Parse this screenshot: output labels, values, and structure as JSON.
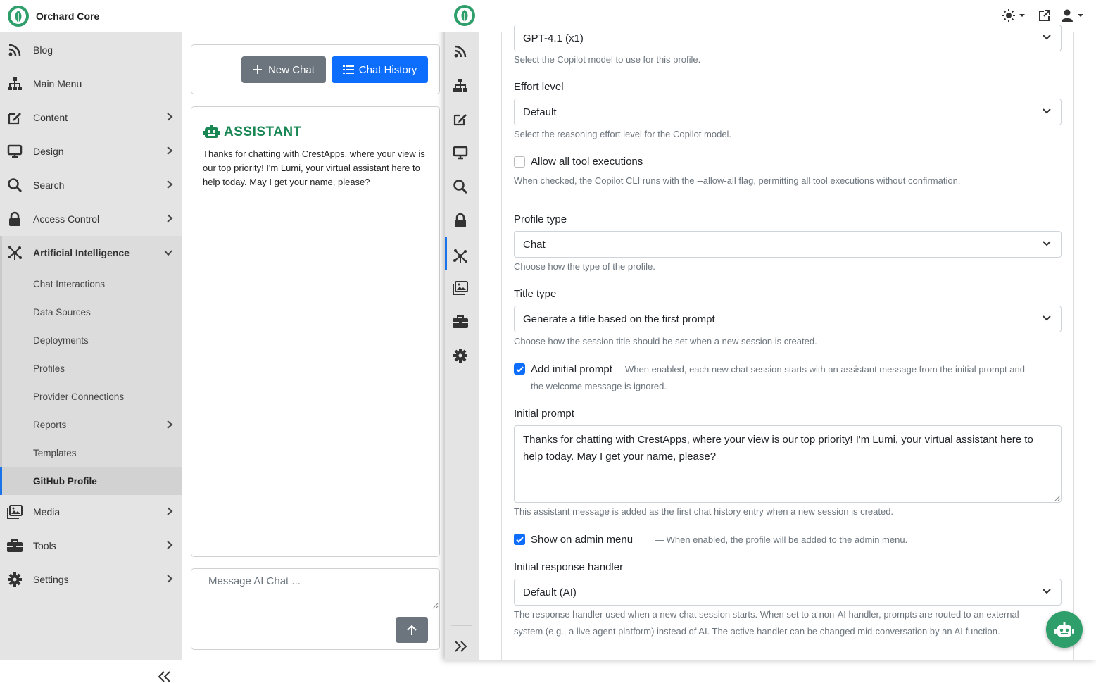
{
  "app": {
    "title": "Orchard Core"
  },
  "sidebar": {
    "items": [
      {
        "label": "Blog",
        "icon": "rss-icon"
      },
      {
        "label": "Main Menu",
        "icon": "sitemap-icon"
      },
      {
        "label": "Content",
        "icon": "edit-icon"
      },
      {
        "label": "Design",
        "icon": "monitor-icon"
      },
      {
        "label": "Search",
        "icon": "search-icon"
      },
      {
        "label": "Access Control",
        "icon": "lock-icon"
      },
      {
        "label": "Artificial Intelligence",
        "icon": "ai-network-icon"
      },
      {
        "label": "Media",
        "icon": "images-icon"
      },
      {
        "label": "Tools",
        "icon": "toolbox-icon"
      },
      {
        "label": "Settings",
        "icon": "gear-icon"
      }
    ],
    "ai_subitems": [
      "Chat Interactions",
      "Data Sources",
      "Deployments",
      "Profiles",
      "Provider Connections",
      "Reports",
      "Templates",
      "GitHub Profile"
    ]
  },
  "chat": {
    "new_chat_label": "New Chat",
    "history_label": "Chat History",
    "assistant_title": "ASSISTANT",
    "assistant_message": "Thanks for chatting with CrestApps, where your view is our top priority! I'm Lumi, your virtual assistant here to help today. May I get your name, please?",
    "input_placeholder": "Message AI Chat ..."
  },
  "form": {
    "model_value": "GPT-4.1 (x1)",
    "model_help": "Select the Copilot model to use for this profile.",
    "effort_label": "Effort level",
    "effort_value": "Default",
    "effort_help": "Select the reasoning effort level for the Copilot model.",
    "allow_tools_label": "Allow all tool executions",
    "allow_tools_help": "When checked, the Copilot CLI runs with the --allow-all flag, permitting all tool executions without confirmation.",
    "profile_type_label": "Profile type",
    "profile_type_value": "Chat",
    "profile_type_help": "Choose how the type of the profile.",
    "title_type_label": "Title type",
    "title_type_value": "Generate a title based on the first prompt",
    "title_type_help": "Choose how the session title should be set when a new session is created.",
    "add_prompt_label": "Add initial prompt",
    "add_prompt_help_1": "When enabled, each new chat session starts with an assistant message from the initial prompt and",
    "add_prompt_help_2": "the welcome message is ignored.",
    "initial_prompt_label": "Initial prompt",
    "initial_prompt_value": "Thanks for chatting with CrestApps, where your view is our top priority! I'm Lumi, your virtual assistant here to help today. May I get your name, please?",
    "initial_prompt_help": "This assistant message is added as the first chat history entry when a new session is created.",
    "show_admin_label": "Show on admin menu",
    "show_admin_help": "— When enabled, the profile will be added to the admin menu.",
    "response_handler_label": "Initial response handler",
    "response_handler_value": "Default (AI)",
    "response_handler_help_1": "The response handler used when a new chat session starts. When set to a non-AI handler, prompts are routed to an external",
    "response_handler_help_2": "system (e.g., a live agent platform) instead of AI. The active handler can be changed mid-conversation by an AI function."
  },
  "colors": {
    "accent": "#0d6efd",
    "brand": "#198754",
    "sidebar_bg": "#e4e4e4"
  }
}
